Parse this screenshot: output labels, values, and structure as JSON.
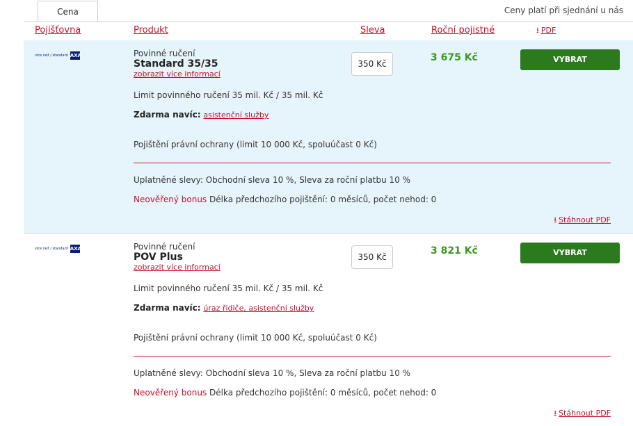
{
  "tabs": {
    "price_tab": "Cena"
  },
  "price_note": "Ceny platí při sjednání u nás",
  "columns": {
    "insurer": "Pojišťovna",
    "product": "Produkt",
    "discount": "Sleva",
    "annual_premium": "Roční pojistné",
    "pdf": "PDF"
  },
  "offers": [
    {
      "insurer_logo": "vice než / standard AXA",
      "product_type": "Povinné ručení",
      "product_name": "Standard 35/35",
      "more_info": "zobrazit více informací",
      "discount_value": "350 Kč",
      "price": "3 675 Kč",
      "select_label": "VYBRAT",
      "limit_text": "Limit povinného ručení 35 mil. Kč / 35 mil. Kč",
      "extras_label": "Zdarma navíc",
      "extras_links": [
        "asistenční služby"
      ],
      "legal_protection": "Pojištění právní ochrany (limit 10 000 Kč, spoluúčast 0 Kč)",
      "applied_discounts": "Uplatněné slevy: Obchodní sleva 10 %, Sleva za roční platbu 10 %",
      "bonus_label": "Neověřený bonus",
      "bonus_text": "Délka předchozího pojištění: 0 měsíců, počet nehod: 0",
      "download_pdf": "Stáhnout PDF"
    },
    {
      "insurer_logo": "vice než / standard AXA",
      "product_type": "Povinné ručení",
      "product_name": "POV Plus",
      "more_info": "zobrazit více informací",
      "discount_value": "350 Kč",
      "price": "3 821 Kč",
      "select_label": "VYBRAT",
      "limit_text": "Limit povinného ručení 35 mil. Kč / 35 mil. Kč",
      "extras_label": "Zdarma navíc",
      "extras_links": [
        "úraz řidiče",
        "asistenční služby"
      ],
      "legal_protection": "Pojištění právní ochrany (limit 10 000 Kč, spoluúčast 0 Kč)",
      "applied_discounts": "Uplatněné slevy: Obchodní sleva 10 %, Sleva za roční platbu 10 %",
      "bonus_label": "Neověřený bonus",
      "bonus_text": "Délka předchozího pojištění: 0 měsíců, počet nehod: 0",
      "download_pdf": "Stáhnout PDF"
    }
  ],
  "colors": {
    "accent_red": "#c8102e",
    "price_green": "#3a9a1e",
    "button_green": "#2b7a1d",
    "highlight_bg": "#e6f4fb",
    "brand_blue": "#0a1e6e"
  },
  "icons": {
    "pdf": "download-icon"
  }
}
